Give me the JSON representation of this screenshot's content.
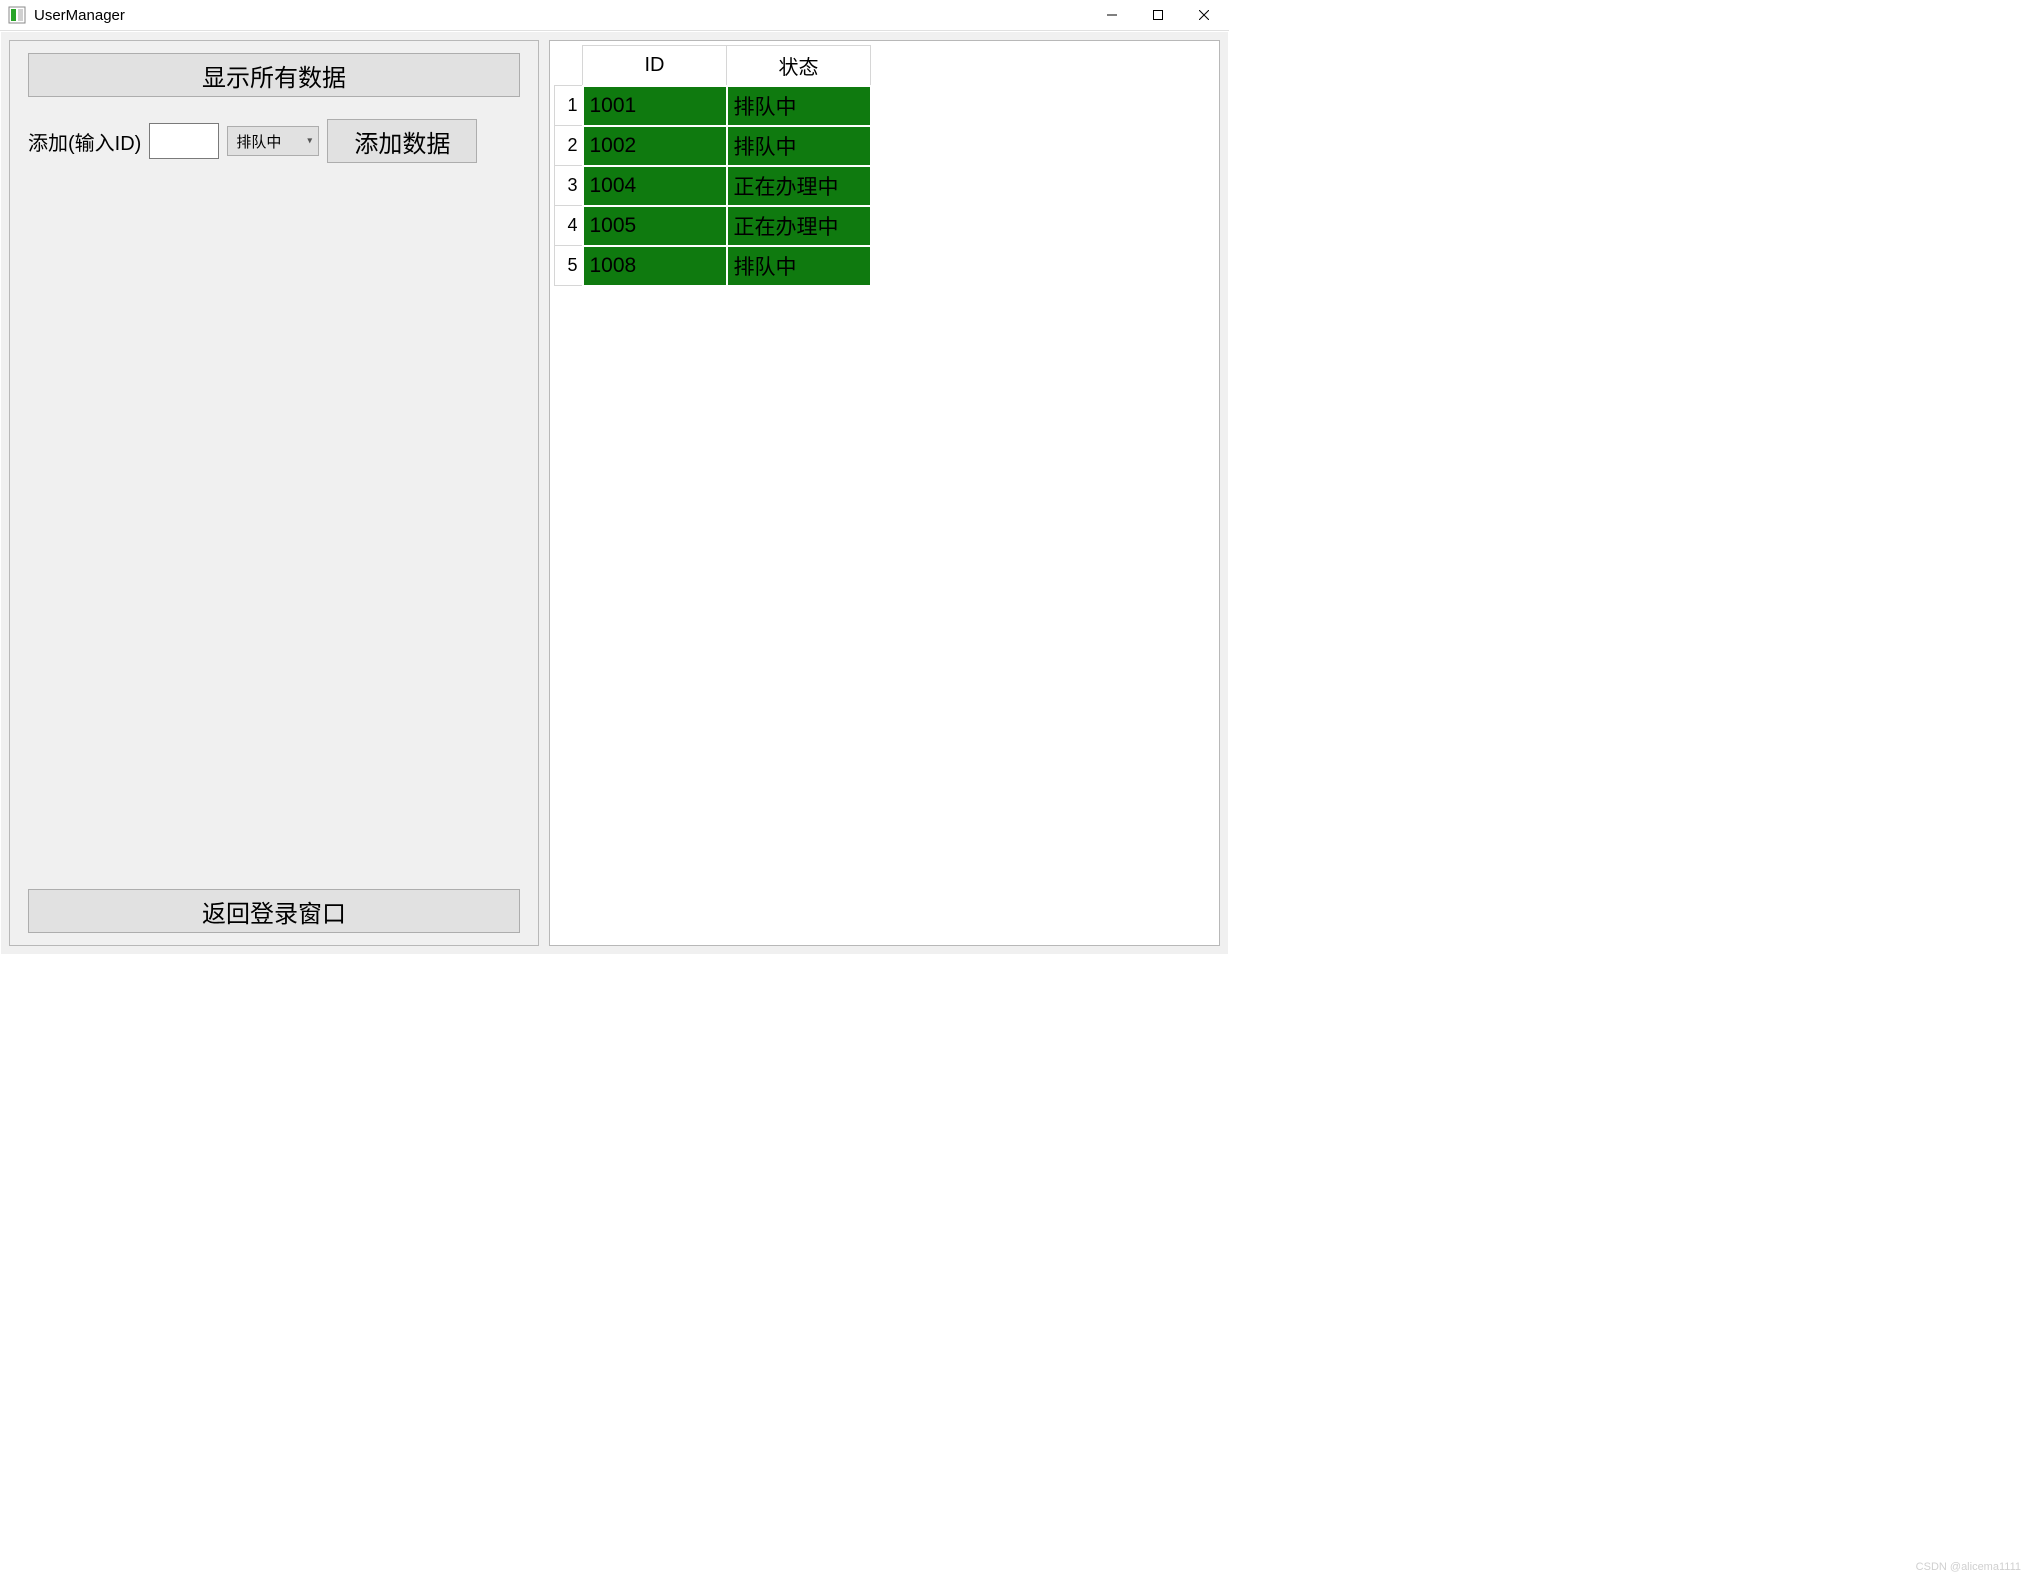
{
  "window": {
    "title": "UserManager"
  },
  "left": {
    "show_all_label": "显示所有数据",
    "add_label": "添加(输入ID)",
    "id_input_value": "",
    "status_selected": "排队中",
    "add_button_label": "添加数据",
    "back_button_label": "返回登录窗口"
  },
  "table": {
    "headers": {
      "id": "ID",
      "status": "状态"
    },
    "rows": [
      {
        "n": "1",
        "id": "1001",
        "status": "排队中"
      },
      {
        "n": "2",
        "id": "1002",
        "status": "排队中"
      },
      {
        "n": "3",
        "id": "1004",
        "status": "正在办理中"
      },
      {
        "n": "4",
        "id": "1005",
        "status": "正在办理中"
      },
      {
        "n": "5",
        "id": "1008",
        "status": "排队中"
      }
    ]
  },
  "watermark": "CSDN @alicema1111"
}
